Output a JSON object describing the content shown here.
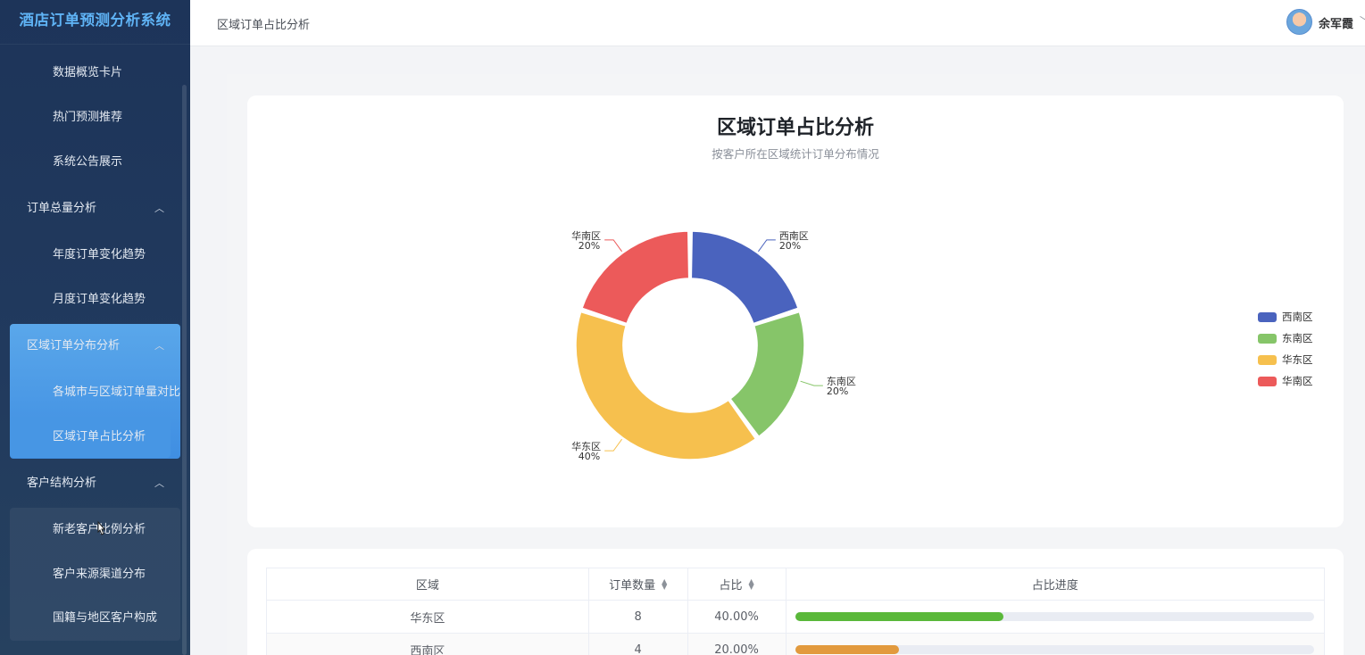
{
  "app": {
    "title": "酒店订单预测分析系统"
  },
  "sidebar": {
    "items": [
      {
        "label": "数据概览卡片"
      },
      {
        "label": "热门预测推荐"
      },
      {
        "label": "系统公告展示"
      }
    ],
    "groups": [
      {
        "label": "订单总量分析",
        "chevron": "chevron-up-icon",
        "children": [
          {
            "label": "年度订单变化趋势"
          },
          {
            "label": "月度订单变化趋势"
          }
        ]
      },
      {
        "label": "区域订单分布分析",
        "chevron": "chevron-up-icon",
        "children": [
          {
            "label": "各城市与区域订单量对比"
          },
          {
            "label": "区域订单占比分析"
          }
        ]
      },
      {
        "label": "客户结构分析",
        "chevron": "chevron-up-icon",
        "children": [
          {
            "label": "新老客户比例分析"
          },
          {
            "label": "客户来源渠道分布"
          },
          {
            "label": "国籍与地区客户构成"
          }
        ]
      }
    ]
  },
  "header": {
    "breadcrumb": "区域订单占比分析",
    "user_name": "余军霞"
  },
  "chart_card": {
    "title": "区域订单占比分析",
    "subtitle": "按客户所在区域统计订单分布情况"
  },
  "chart_data": {
    "type": "pie",
    "title": "区域订单占比分析",
    "subtitle": "按客户所在区域统计订单分布情况",
    "donut": true,
    "legend": "right",
    "categories": [
      "西南区",
      "东南区",
      "华东区",
      "华南区"
    ],
    "values": [
      4,
      4,
      8,
      4
    ],
    "percent_labels": [
      "20%",
      "20%",
      "40%",
      "20%"
    ],
    "colors": [
      "#4a63be",
      "#86c569",
      "#f6c04e",
      "#ec5a5a"
    ]
  },
  "table": {
    "headers": [
      "区域",
      "订单数量",
      "占比",
      "占比进度"
    ],
    "rows": [
      {
        "region": "华东区",
        "count": "8",
        "percent": "40.00%",
        "progress": 0.4,
        "color": "#5ab83a"
      },
      {
        "region": "西南区",
        "count": "4",
        "percent": "20.00%",
        "progress": 0.2,
        "color": "#e29a3d"
      }
    ]
  }
}
